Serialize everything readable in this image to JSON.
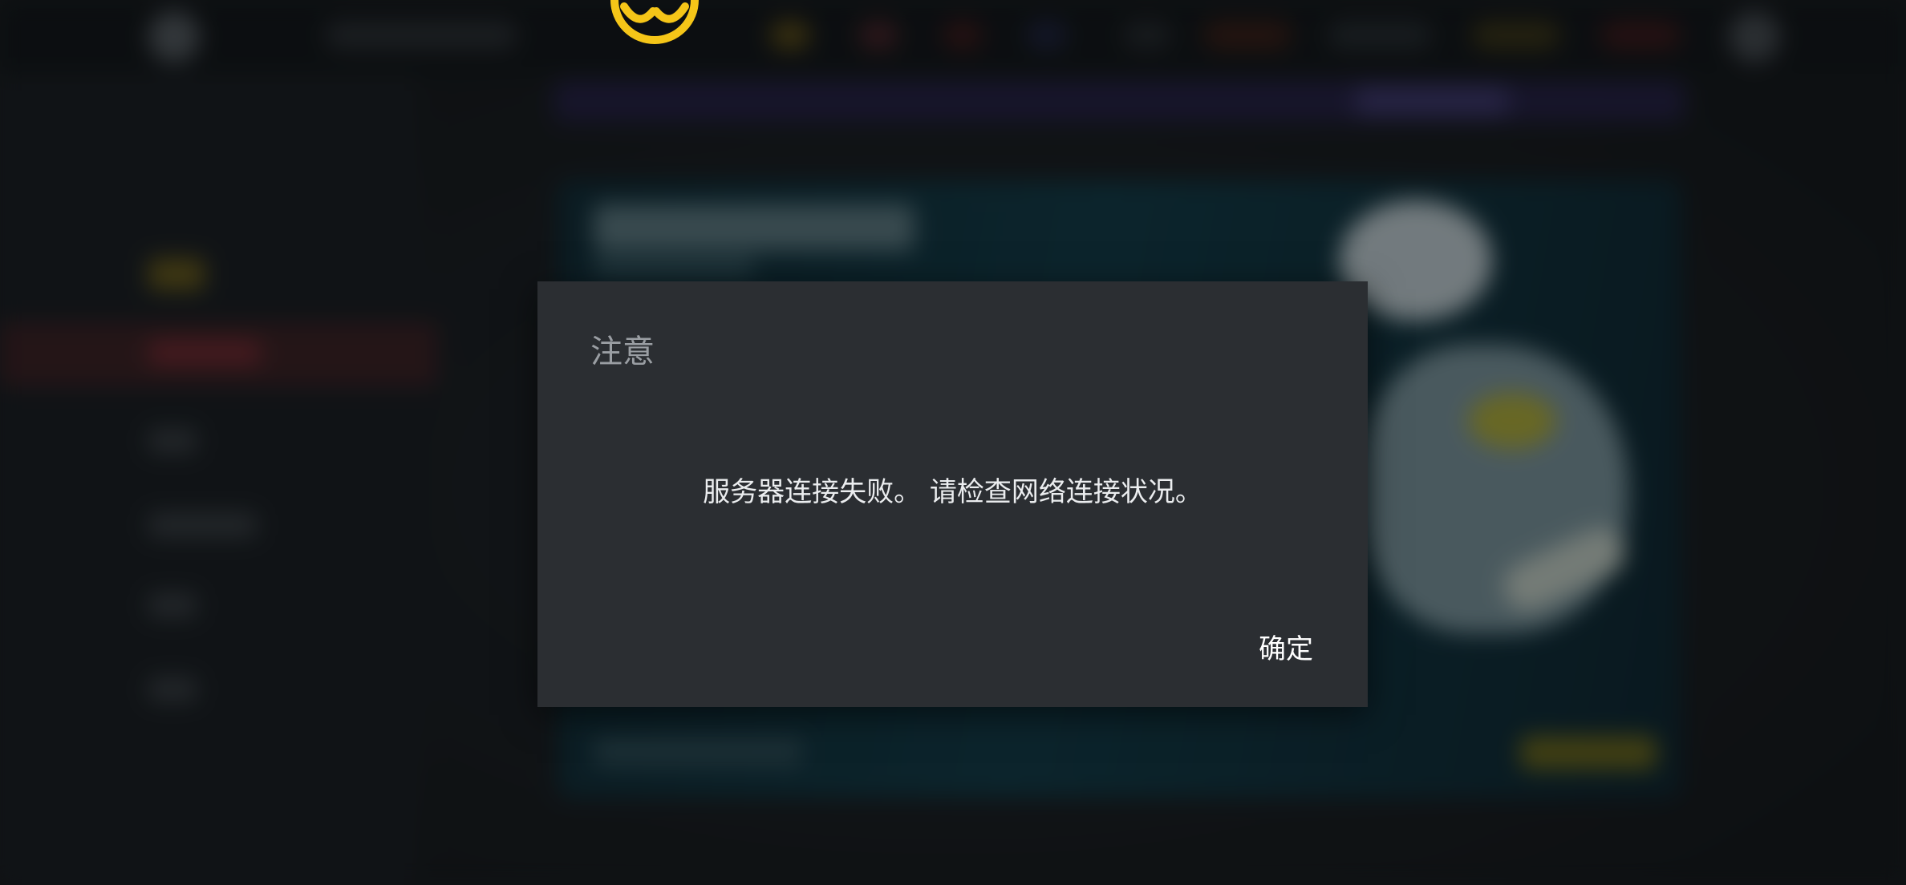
{
  "dialog": {
    "title": "注意",
    "message": "服务器连接失败。 请检查网络连接状况。",
    "confirm_label": "确定"
  },
  "colors": {
    "dialog_background": "#2b2e32",
    "title_text": "#9a9ea3",
    "message_text": "#ebedef",
    "button_text": "#ffffff",
    "logo_yellow": "#f5c518"
  },
  "icons": {
    "app_logo": "yellow-ring-logo-icon"
  }
}
